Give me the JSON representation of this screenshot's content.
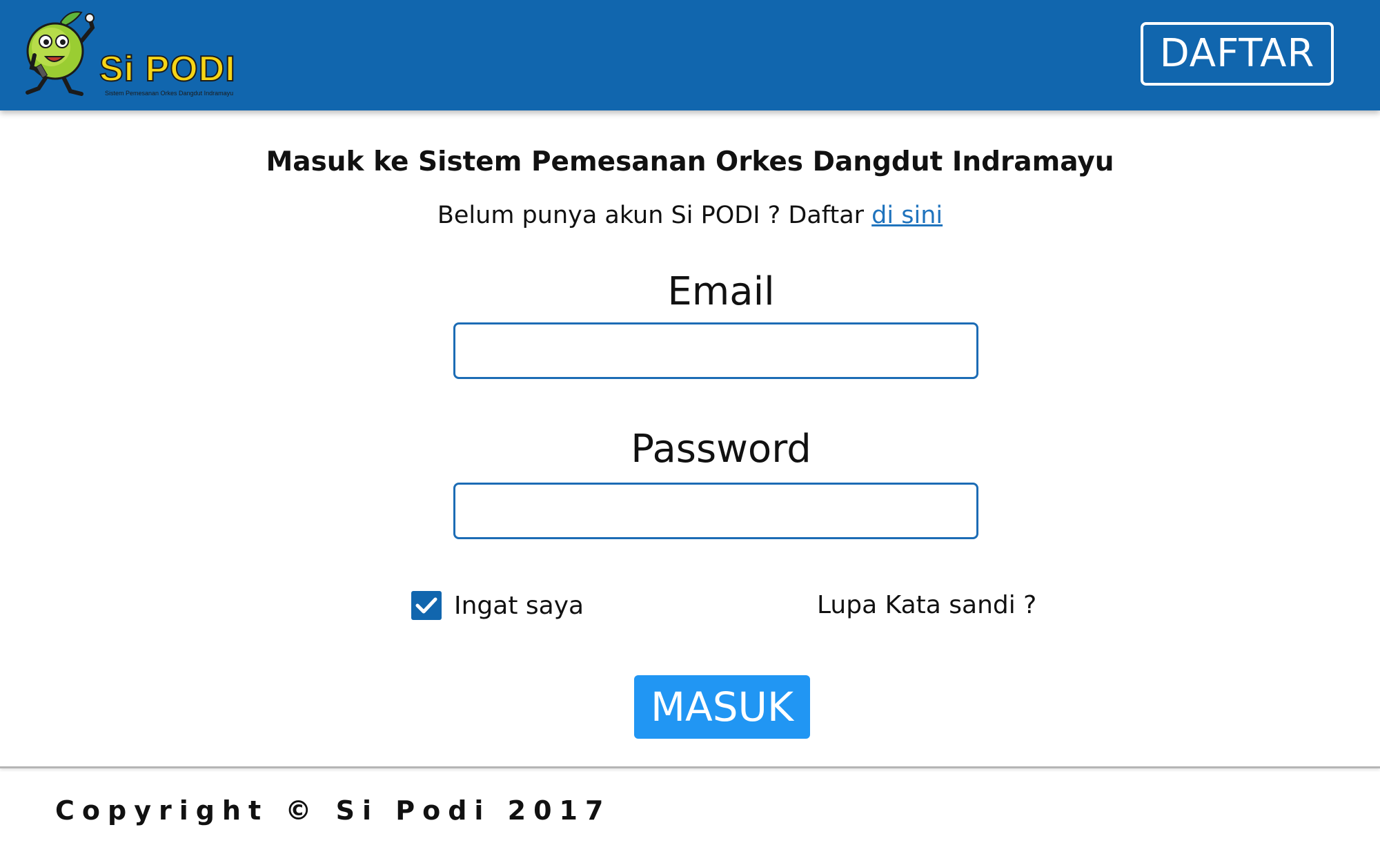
{
  "header": {
    "logo_title": "Si PODI",
    "logo_subtitle": "Sistem Pemesanan Orkes Dangdut Indramayu",
    "register_button": "DAFTAR",
    "background_color": "#1166ae"
  },
  "main": {
    "title": "Masuk ke Sistem Pemesanan Orkes Dangdut Indramayu",
    "subtitle_text": "Belum punya akun Si PODI ? Daftar ",
    "subtitle_link": "di sini",
    "email_label": "Email",
    "email_value": "",
    "password_label": "Password",
    "password_value": "",
    "remember_label": "Ingat saya",
    "remember_checked": true,
    "forgot_label": "Lupa Kata sandi ?",
    "login_button": "MASUK",
    "accent_color": "#2196f3",
    "link_color": "#1f73bd"
  },
  "footer": {
    "copyright": "Copyright © Si Podi 2017"
  }
}
